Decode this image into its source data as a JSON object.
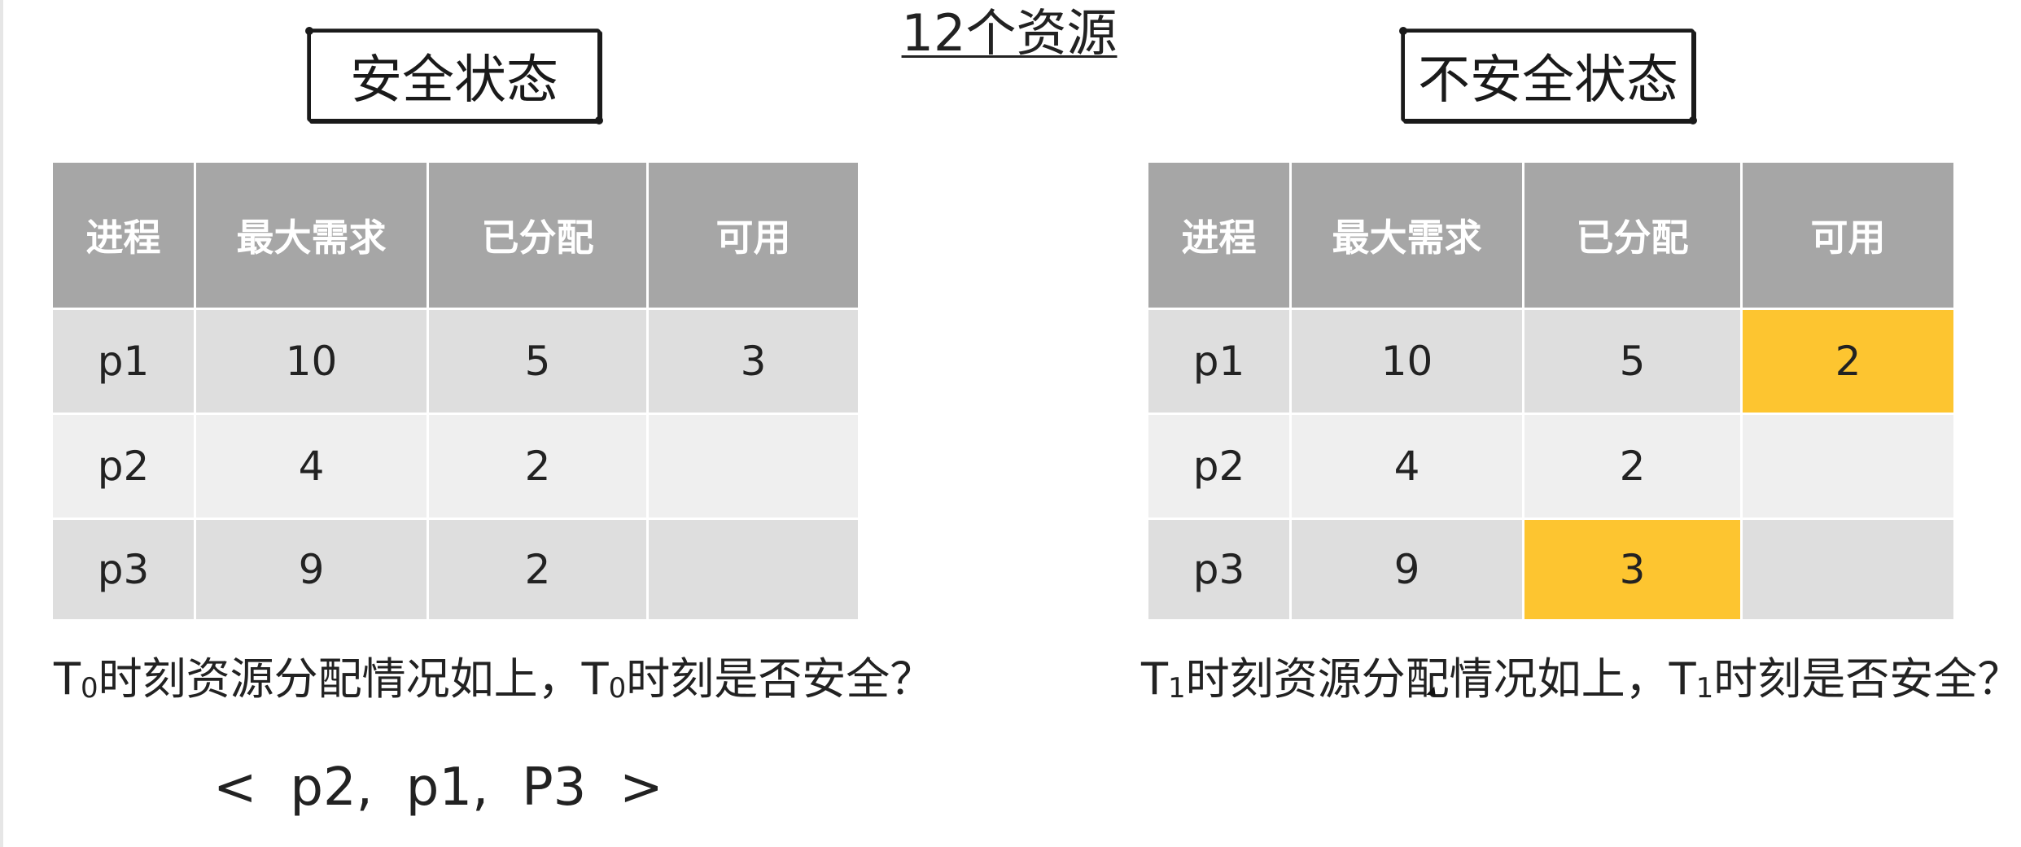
{
  "title": "12个资源",
  "left": {
    "state_label": "安全状态",
    "headers": [
      "进程",
      "最大需求",
      "已分配",
      "可用"
    ],
    "rows": [
      [
        "p1",
        "10",
        "5",
        "3"
      ],
      [
        "p2",
        "4",
        "2",
        ""
      ],
      [
        "p3",
        "9",
        "2",
        ""
      ]
    ],
    "question": {
      "t1": "T",
      "sub1": "0",
      "mid": "时刻资源分配情况如上，",
      "t2": "T",
      "sub2": "0",
      "end": "时刻是否安全？"
    },
    "sequence": "<  p2,  p1,  P3  >"
  },
  "right": {
    "state_label": "不安全状态",
    "headers": [
      "进程",
      "最大需求",
      "已分配",
      "可用"
    ],
    "rows": [
      [
        "p1",
        "10",
        "5",
        "2"
      ],
      [
        "p2",
        "4",
        "2",
        ""
      ],
      [
        "p3",
        "9",
        "3",
        ""
      ]
    ],
    "question": {
      "t1": "T",
      "sub1": "1",
      "mid": "时刻资源分配情况如上，",
      "t2": "T",
      "sub2": "1",
      "end": "时刻是否安全？"
    }
  },
  "colors": {
    "header_bg": "#a6a6a6",
    "row_dark": "#dedede",
    "row_light": "#efefef",
    "highlight": "#fdc530"
  }
}
